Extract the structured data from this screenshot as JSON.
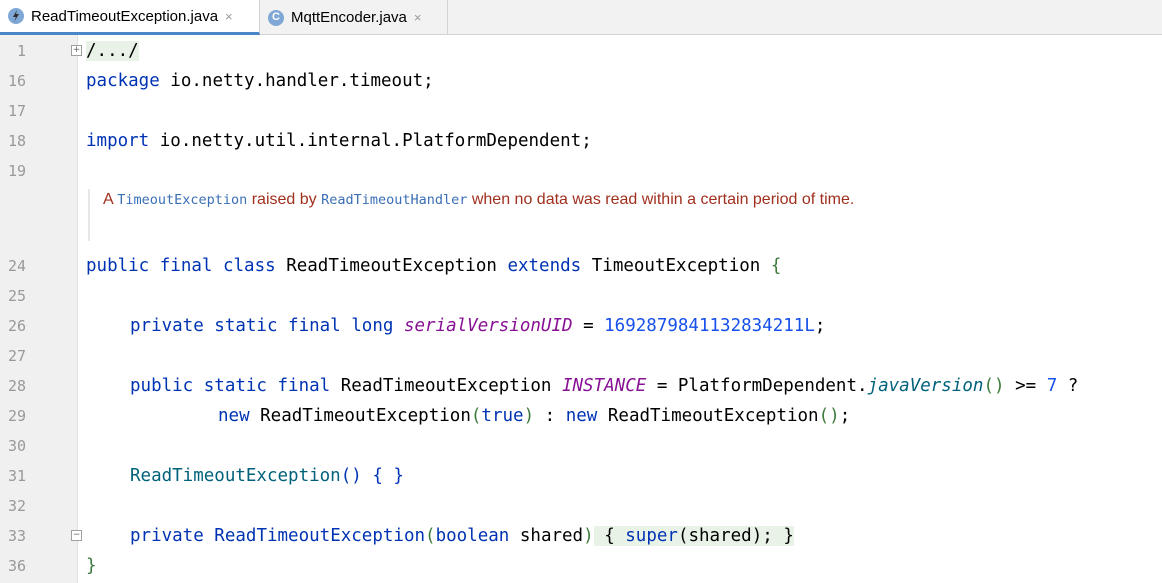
{
  "tabs": [
    {
      "label": "ReadTimeoutException.java",
      "close": "×",
      "icon": "exception-class-icon"
    },
    {
      "label": "MqttEncoder.java",
      "close": "×",
      "icon": "class-icon"
    }
  ],
  "line_numbers": [
    "1",
    "16",
    "17",
    "18",
    "19",
    "24",
    "25",
    "26",
    "27",
    "28",
    "29",
    "30",
    "31",
    "32",
    "33",
    "36"
  ],
  "code": {
    "l1": "/.../",
    "l16_kw": "package",
    "l16_rest": " io.netty.handler.timeout;",
    "l18_kw": "import",
    "l18_rest": " io.netty.util.internal.PlatformDependent;",
    "l24_kw": "public final class",
    "l24_name": " ReadTimeoutException ",
    "l24_ext": "extends",
    "l24_super": " TimeoutException ",
    "l24_brace": "{",
    "l26_kw": "private static final long",
    "l26_field": "serialVersionUID",
    "l26_eq": " = ",
    "l26_num": "1692879841132834211L",
    "l26_semi": ";",
    "l28_kw": "public static final",
    "l28_type": " ReadTimeoutException ",
    "l28_field": "INSTANCE",
    "l28_eq": " = PlatformDependent.",
    "l28_method": "javaVersion",
    "l28_paren": "()",
    "l28_cmp": " >= ",
    "l28_num": "7",
    "l28_q": " ?",
    "l29_new1": "new",
    "l29_ctor1": " ReadTimeoutException",
    "l29_p1": "(",
    "l29_true": "true",
    "l29_p2": ")",
    "l29_colon": " : ",
    "l29_new2": "new",
    "l29_ctor2": " ReadTimeoutException",
    "l29_p3": "()",
    "l29_semi": ";",
    "l31_ctor": "ReadTimeoutException",
    "l31_rest": "() { }",
    "l33_kw": "private",
    "l33_ctor": " ReadTimeoutException",
    "l33_p1": "(",
    "l33_bool": "boolean",
    "l33_arg": " shared",
    "l33_p2": ")",
    "l33_open": " { ",
    "l33_super": "super",
    "l33_call": "(shared); ",
    "l33_close": "}",
    "l36": "}"
  },
  "doc": {
    "a": "A ",
    "c1": "TimeoutException",
    "b": " raised by ",
    "c2": "ReadTimeoutHandler",
    "c": " when no data was read within a certain period of time."
  }
}
